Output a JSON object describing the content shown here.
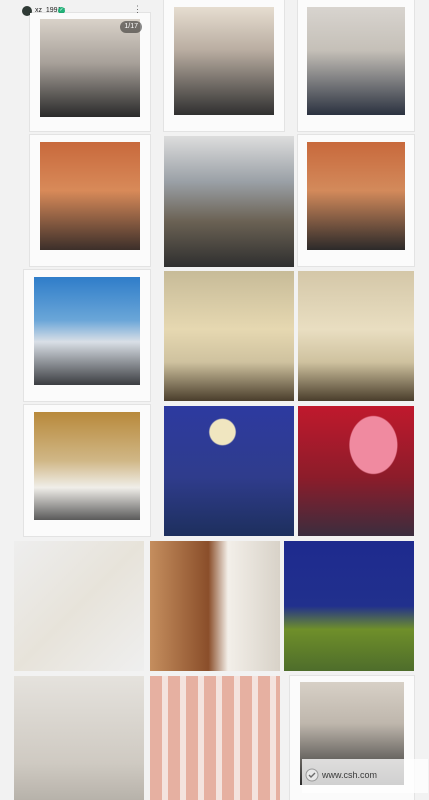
{
  "header": {
    "username": "xz_1991x",
    "verified_badge": "verified-icon",
    "more_icon": "⋮"
  },
  "grid": {
    "tiles": [
      {
        "id": "tile-01",
        "type": "polaroid",
        "pager": "1/17"
      },
      {
        "id": "tile-02",
        "type": "polaroid"
      },
      {
        "id": "tile-03",
        "type": "polaroid"
      },
      {
        "id": "tile-04",
        "type": "polaroid"
      },
      {
        "id": "tile-05",
        "type": "full"
      },
      {
        "id": "tile-06",
        "type": "polaroid"
      },
      {
        "id": "tile-07",
        "type": "polaroid"
      },
      {
        "id": "tile-08",
        "type": "full"
      },
      {
        "id": "tile-09",
        "type": "full"
      },
      {
        "id": "tile-10",
        "type": "polaroid"
      },
      {
        "id": "tile-11",
        "type": "full"
      },
      {
        "id": "tile-12",
        "type": "full"
      },
      {
        "id": "tile-13",
        "type": "full"
      },
      {
        "id": "tile-14",
        "type": "full"
      },
      {
        "id": "tile-15",
        "type": "full"
      },
      {
        "id": "tile-16",
        "type": "full"
      },
      {
        "id": "tile-17",
        "type": "full"
      },
      {
        "id": "tile-18",
        "type": "polaroid"
      }
    ]
  },
  "watermark": {
    "text": "www.csh.com"
  }
}
